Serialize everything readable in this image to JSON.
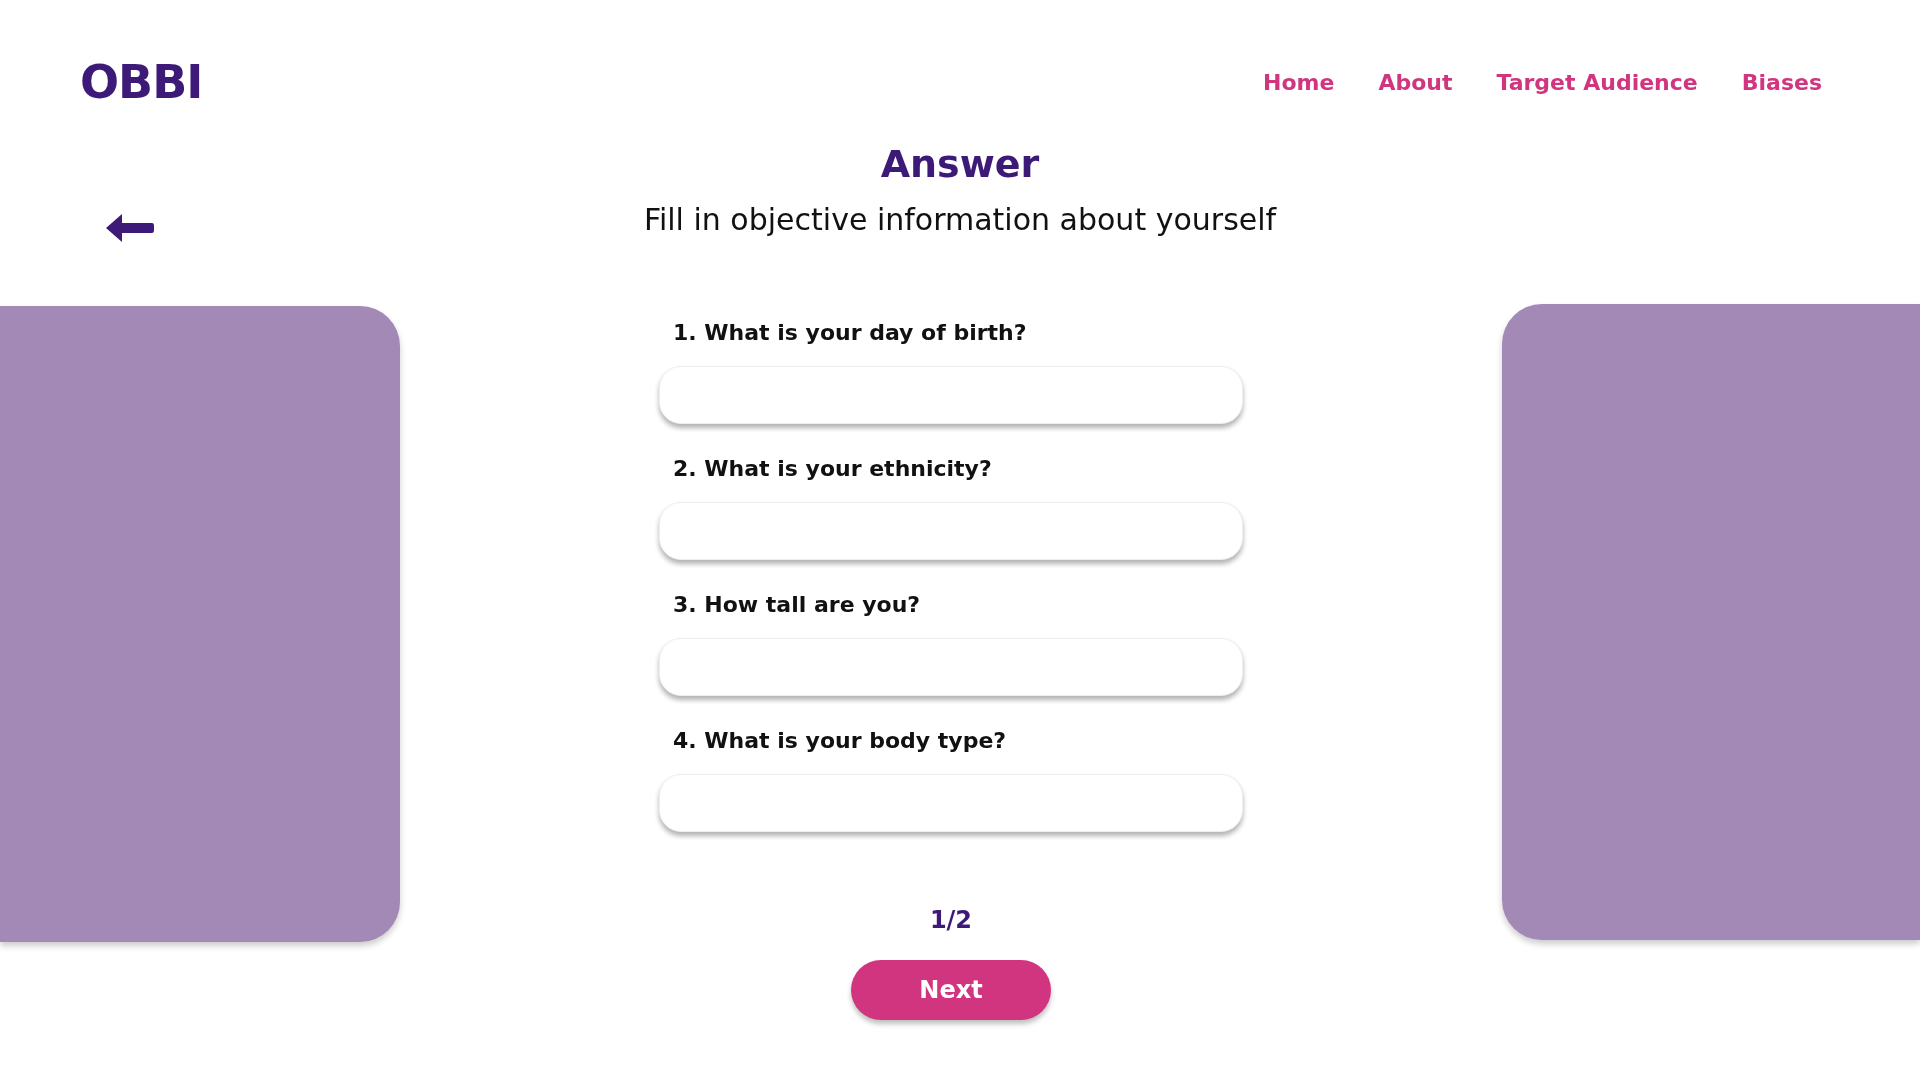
{
  "logo": "OBBI",
  "nav": [
    {
      "label": "Home"
    },
    {
      "label": "About"
    },
    {
      "label": "Target Audience"
    },
    {
      "label": "Biases"
    }
  ],
  "title": "Answer",
  "subtitle": "Fill in objective information about yourself",
  "questions": [
    {
      "label": "1. What is your day of birth?"
    },
    {
      "label": "2. What is your ethnicity?"
    },
    {
      "label": "3. How tall are you?"
    },
    {
      "label": "4. What is your body type?"
    }
  ],
  "page": "1/2",
  "next_button": "Next"
}
